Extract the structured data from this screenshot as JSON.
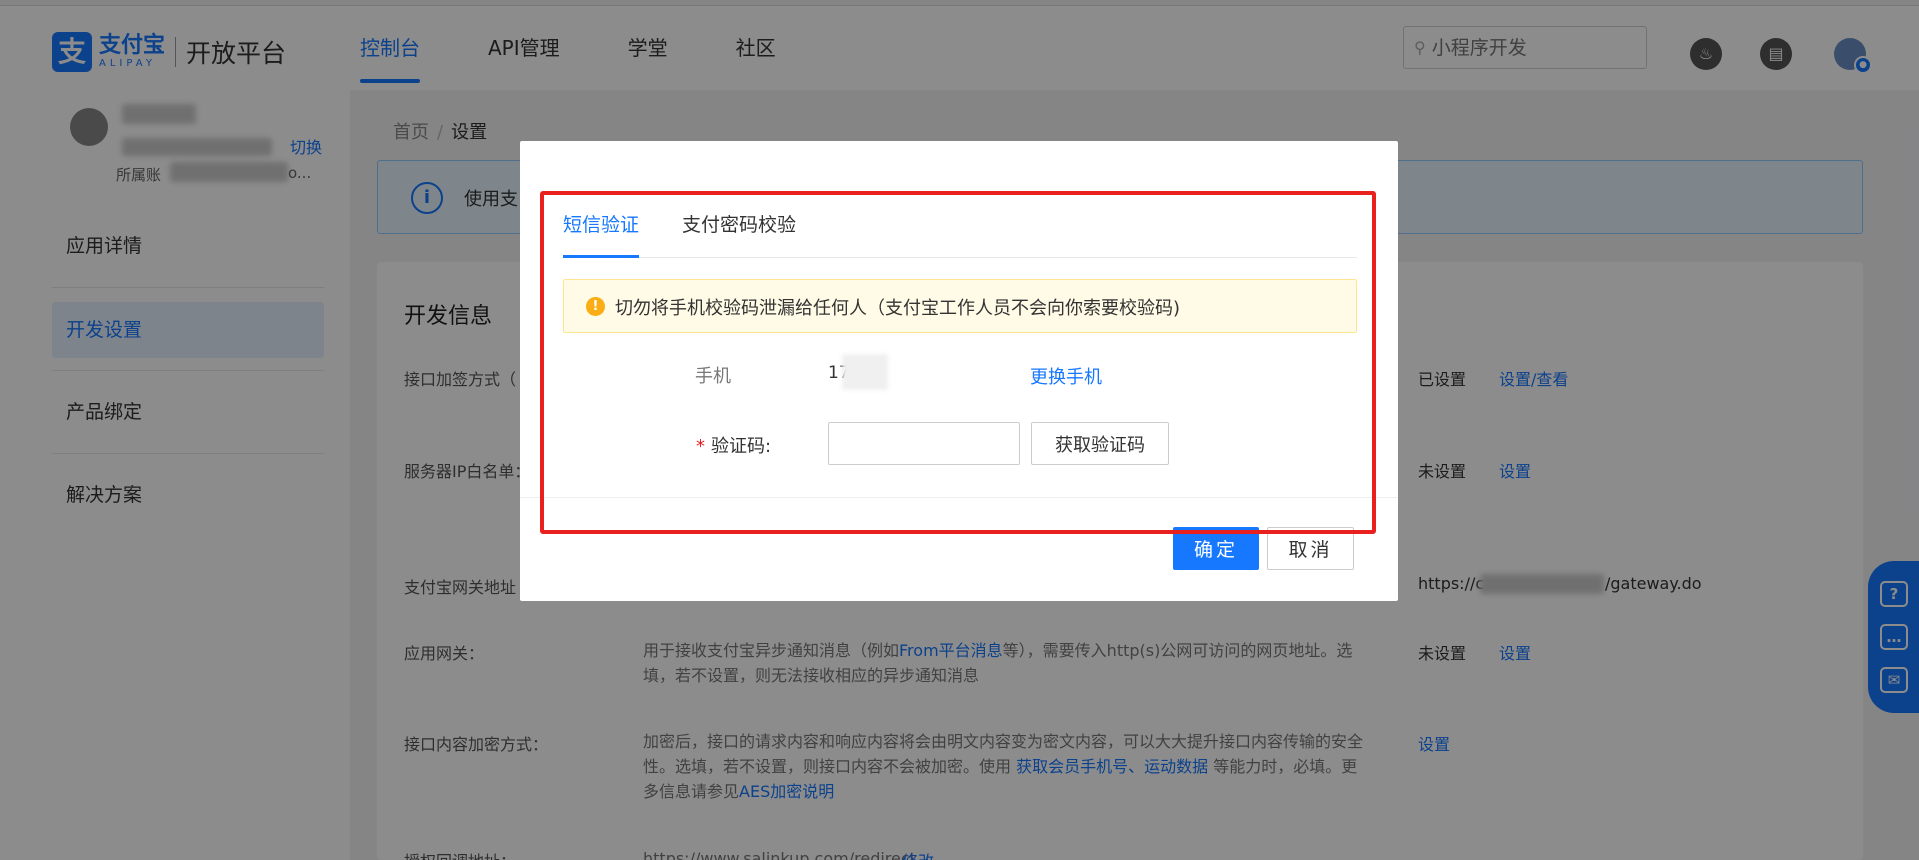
{
  "header": {
    "logo_mark": "支",
    "logo_cn": "支付宝",
    "logo_en": "ALIPAY",
    "platform": "开放平台",
    "nav": [
      "控制台",
      "API管理",
      "学堂",
      "社区"
    ],
    "search_placeholder": "小程序开发"
  },
  "sidebar": {
    "switch_label": "切换",
    "owner_label": "所属账",
    "owner_tail": "o...",
    "menu": [
      "应用详情",
      "开发设置",
      "产品绑定",
      "解决方案"
    ]
  },
  "breadcrumb": {
    "home": "首页",
    "sep": "/",
    "current": "设置"
  },
  "banner": {
    "text": "使用支"
  },
  "dev_info": {
    "title": "开发信息",
    "rows": {
      "sign": {
        "label": "接口加签方式（",
        "status": "已设置",
        "link": "设置/查看"
      },
      "ip": {
        "label": "服务器IP白名单：",
        "status": "未设置",
        "link": "设置"
      },
      "gateway": {
        "label": "支付宝网关地址",
        "value_start": "https://c",
        "value_end": "/gateway.do"
      },
      "app_gateway": {
        "label": "应用网关：",
        "desc_1": "用于接收支付宝异步通知消息（例如",
        "desc_link": "From平台消息",
        "desc_2": "等），需要传入http(s)公网可访问的网页地址。选填，若不设置，则无法接收相应的异步通知消息",
        "status": "未设置",
        "link": "设置"
      },
      "encrypt": {
        "label": "接口内容加密方式：",
        "desc_1": "加密后，接口的请求内容和响应内容将会由明文内容变为密文内容，可以大大提升接口内容传输的安全性。选填，若不设置，则接口内容不会被加密。使用 ",
        "desc_link1": "获取会员手机号、运动数据",
        "desc_2": " 等能力时，必填。更多信息请参见",
        "desc_link2": "AES加密说明",
        "link": "设置"
      },
      "redirect": {
        "label": "授权回调地址：",
        "value": "https://www.salinkup.com/redirect",
        "link": "修改"
      }
    }
  },
  "float_bar": {
    "icons": [
      "question-icon",
      "chat-icon",
      "feedback-icon"
    ],
    "glyphs": [
      "?",
      "…",
      "✉"
    ]
  },
  "modal": {
    "tabs": [
      "短信验证",
      "支付密码校验"
    ],
    "warning": "切勿将手机校验码泄漏给任何人（支付宝工作人员不会向你索要校验码)",
    "warning_icon": "!",
    "phone_label": "手机",
    "phone_value": "17        37",
    "change_phone": "更换手机",
    "required_mark": "*",
    "code_label": "验证码:",
    "get_code": "获取验证码",
    "ok": "确定",
    "cancel": "取消",
    "highlight_color": "#e8211f"
  }
}
